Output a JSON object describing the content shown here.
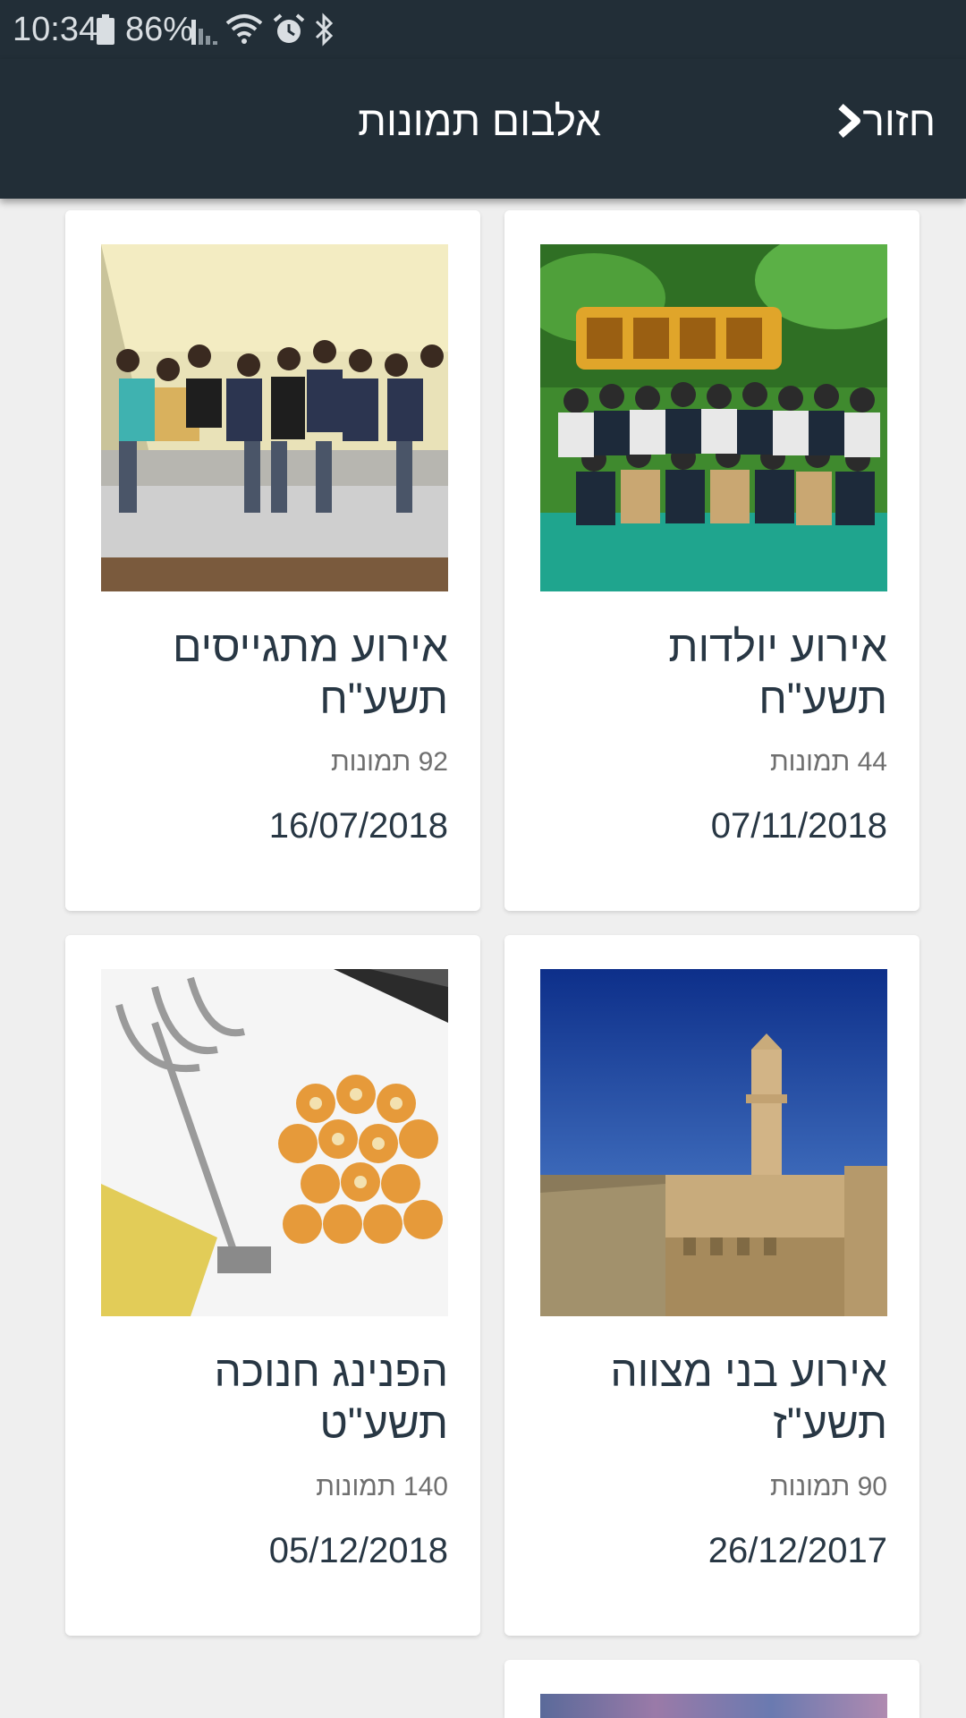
{
  "status_bar": {
    "time": "10:34",
    "battery_percent": "86%",
    "icons": [
      "battery-icon",
      "signal-icon",
      "wifi-icon",
      "alarm-icon",
      "bluetooth-icon"
    ]
  },
  "app_bar": {
    "title": "אלבום תמונות",
    "back_label": "חזור",
    "background_color": "#222e37"
  },
  "albums": [
    {
      "title_line1": "אירוע יולדות",
      "title_line2": "תשע\"ח",
      "photo_count": "44 תמונות",
      "date": "07/11/2018",
      "image": "group-photo-jungle-backdrop"
    },
    {
      "title_line1": "אירוע מתגייסים",
      "title_line2": "תשע\"ח",
      "photo_count": "92 תמונות",
      "date": "16/07/2018",
      "image": "group-photo-sitting"
    },
    {
      "title_line1": "אירוע בני מצווה",
      "title_line2": "תשע\"ז",
      "photo_count": "90 תמונות",
      "date": "26/12/2017",
      "image": "tower-of-david"
    },
    {
      "title_line1": "הפנינג חנוכה",
      "title_line2": "תשע\"ט",
      "photo_count": "140 תמונות",
      "date": "05/12/2018",
      "image": "menorah-donuts"
    }
  ]
}
